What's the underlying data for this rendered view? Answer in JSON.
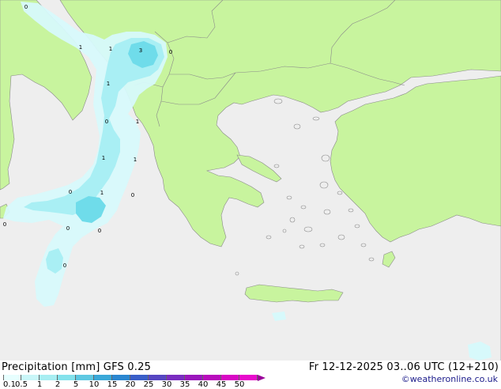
{
  "title": "Precipitation [mm]  GFS 0.25",
  "run_info": "Fr 12-12-2025 03..06 UTC (12+210)",
  "credit": "©weatheronline.co.uk",
  "legend": {
    "ticks": [
      "0.1",
      "0.5",
      "1",
      "2",
      "5",
      "10",
      "15",
      "20",
      "25",
      "30",
      "35",
      "40",
      "45",
      "50"
    ],
    "colors": [
      "#e7fefe",
      "#c9f6f8",
      "#a8eef2",
      "#84e2ec",
      "#5ec8e2",
      "#3aa8d8",
      "#2a86d0",
      "#3a5ec8",
      "#5646c2",
      "#7a2cc0",
      "#9a16bc",
      "#b80cbc",
      "#d808c4",
      "#e80acc"
    ]
  },
  "map": {
    "land_color": "#c8f49e",
    "sea_color": "#eeeeee",
    "precip_light": "#d7f9fb",
    "precip_mid": "#a6eef3",
    "precip_heavy": "#6fdcea",
    "labels": [
      "0",
      "1",
      "1",
      "3",
      "0",
      "1",
      "0",
      "1",
      "1",
      "1",
      "0",
      "1",
      "0",
      "0",
      "0",
      "0",
      "0"
    ]
  }
}
